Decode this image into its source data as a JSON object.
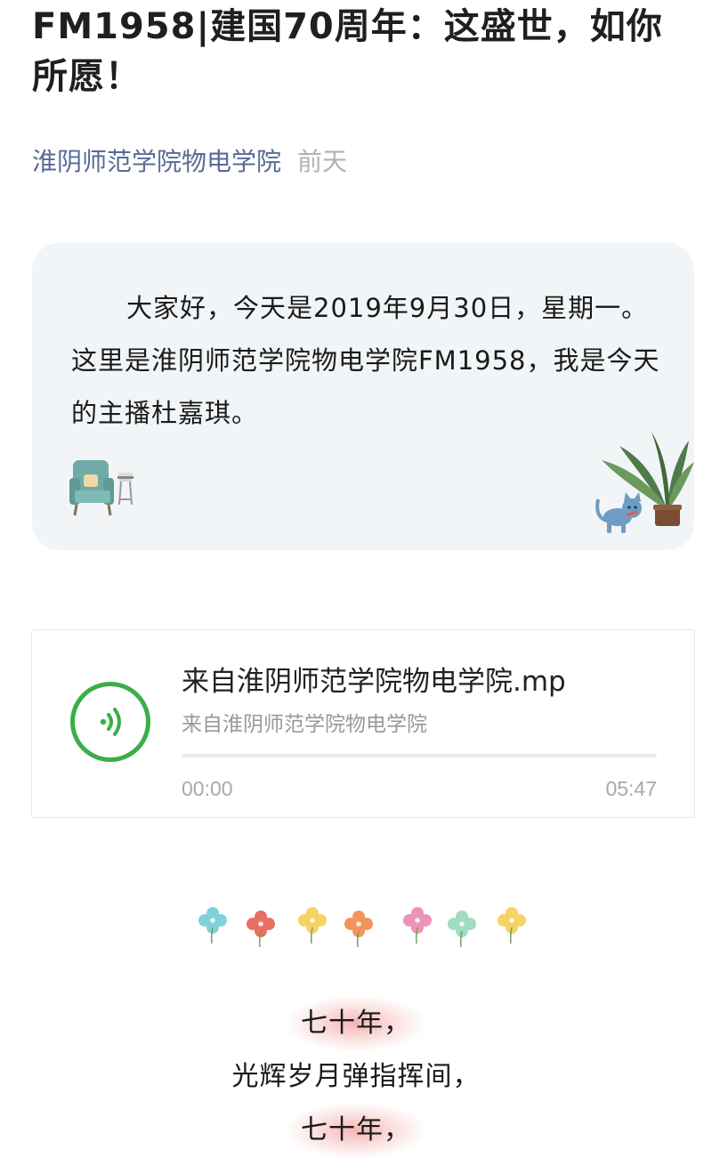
{
  "article": {
    "title": "FM1958|建国70周年：这盛世，如你所愿！",
    "account": "淮阴师范学院物电学院",
    "date": "前天"
  },
  "intro": {
    "text": "大家好，今天是2019年9月30日，星期一。这里是淮阴师范学院物电学院FM1958，我是今天的主播杜嘉琪。"
  },
  "audio": {
    "title": "来自淮阴师范学院物电学院.mp",
    "source": "来自淮阴师范学院物电学院",
    "current_time": "00:00",
    "duration": "05:47",
    "progress": 0,
    "accent_color": "#3aaf47"
  },
  "decorations": {
    "icons": [
      "armchair-icon",
      "potted-plant-icon",
      "cat-icon",
      "flower-icon"
    ],
    "flower_colors": [
      "#7fd3d8",
      "#ea6f62",
      "#f6d365",
      "#f2955b",
      "#ee93b8",
      "#9fdcc2",
      "#f6d365"
    ]
  },
  "poem": {
    "lines": [
      "七十年，",
      "光辉岁月弹指挥间，",
      "七十年，"
    ],
    "highlight_color": "#f4acac"
  }
}
